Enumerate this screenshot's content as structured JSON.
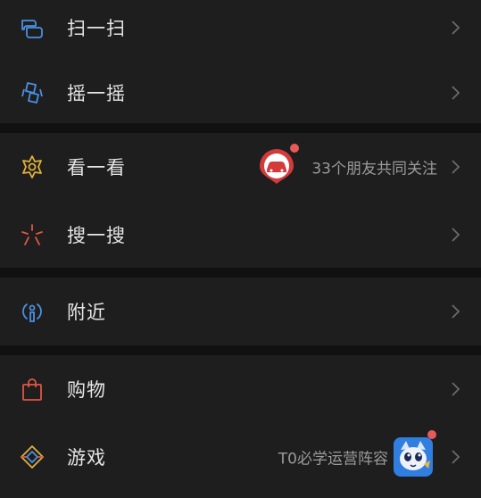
{
  "colors": {
    "background": "#111111",
    "card": "#1e1e1e",
    "label": "#e6e6e6",
    "secondary": "#9a9a9a",
    "chevron": "#6a6a6a",
    "dot": "#e85a5a"
  },
  "items": [
    {
      "label": "扫一扫",
      "icon": "scan-icon"
    },
    {
      "label": "摇一摇",
      "icon": "shake-icon"
    },
    {
      "label": "看一看",
      "icon": "top-stories-icon",
      "right_text": "33个朋友共同关注",
      "badge_icon": "red-car-logo-icon"
    },
    {
      "label": "搜一搜",
      "icon": "search-sparkle-icon"
    },
    {
      "label": "附近",
      "icon": "nearby-icon"
    },
    {
      "label": "购物",
      "icon": "shopping-bag-icon"
    },
    {
      "label": "游戏",
      "icon": "game-icon",
      "right_text": "T0必学运营阵容",
      "badge_icon": "game-character-avatar-icon"
    }
  ]
}
